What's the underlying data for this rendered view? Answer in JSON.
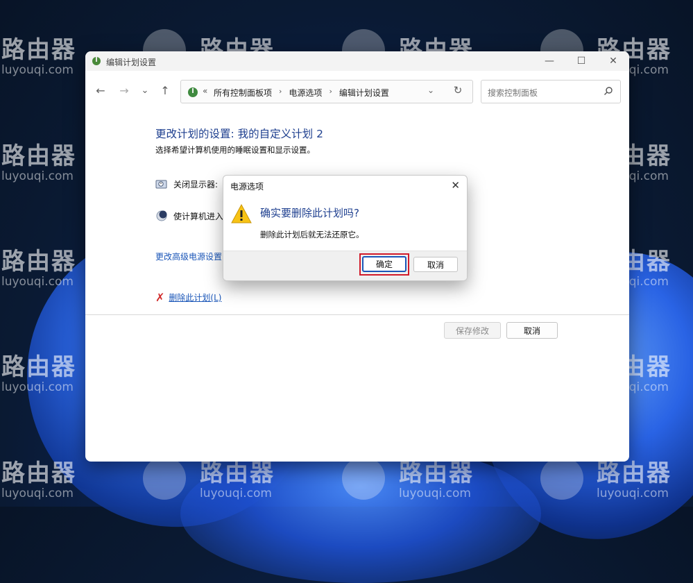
{
  "window": {
    "title": "编辑计划设置",
    "controls": {
      "minimize": "—",
      "maximize": "☐",
      "close": "✕"
    }
  },
  "nav": {
    "back": "←",
    "forward": "→",
    "recent": "⌄",
    "up": "↑",
    "breadcrumb_chevron": "«",
    "breadcrumbs": [
      "所有控制面板项",
      "电源选项",
      "编辑计划设置"
    ],
    "separator": "›",
    "dropdown": "⌄",
    "refresh": "↻",
    "search_placeholder": "搜索控制面板"
  },
  "main": {
    "heading": "更改计划的设置: 我的自定义计划 2",
    "subheading": "选择希望计算机使用的睡眠设置和显示设置。",
    "display_off_label": "关闭显示器:",
    "sleep_label": "使计算机进入",
    "advanced_link": "更改高级电源设置",
    "delete_link": "删除此计划(L)",
    "save_button": "保存修改",
    "cancel_button": "取消"
  },
  "dialog": {
    "title": "电源选项",
    "question": "确实要删除此计划吗?",
    "message": "删除此计划后就无法还原它。",
    "ok_button": "确定",
    "cancel_button": "取消"
  },
  "watermark": {
    "cn": "路由器",
    "en": "luyouqi.com"
  }
}
